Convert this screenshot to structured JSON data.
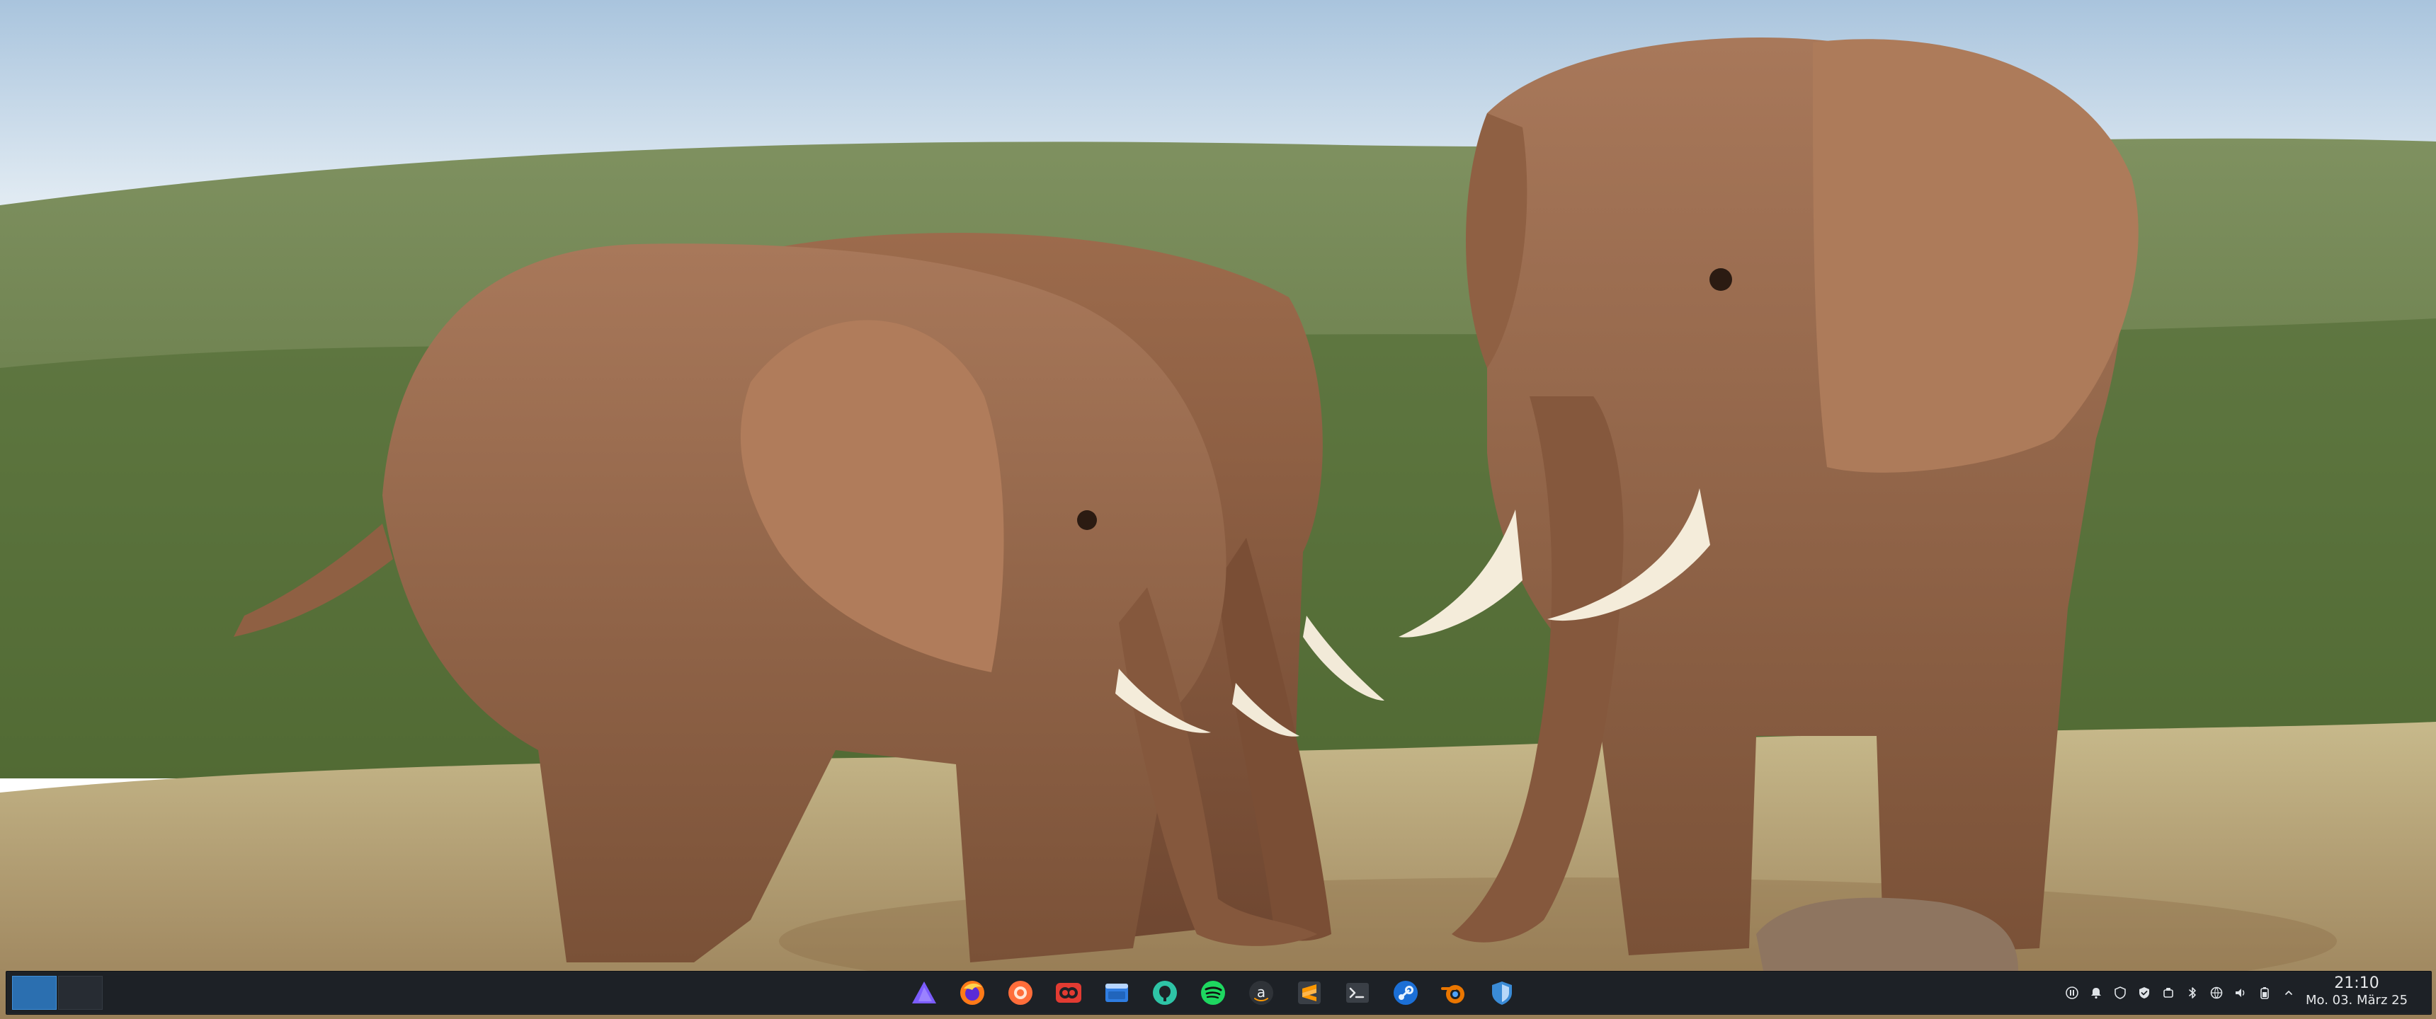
{
  "desktop": {
    "wallpaper": "elephants",
    "sky_color": "#c9d8e6",
    "hills_color": "#6f8450",
    "grass_color": "#c9b889",
    "elephant_color": "#9a6b4c"
  },
  "taskbar": {
    "background": "#1d2126",
    "pager": {
      "desktops": 2,
      "active": 1
    },
    "tasks": [
      {
        "name": "proton-vpn",
        "icon": "triangle-icon",
        "color": "#7b5cff"
      },
      {
        "name": "firefox",
        "icon": "firefox-icon",
        "color": "#ff7a18"
      },
      {
        "name": "orange-circle-app",
        "icon": "orange-circle-icon",
        "color": "#ff6d3a"
      },
      {
        "name": "davinci-resolve",
        "icon": "resolve-icon",
        "color": "#e23b32"
      },
      {
        "name": "file-manager",
        "icon": "folder-window-icon",
        "color": "#2f7de1"
      },
      {
        "name": "github-desktop",
        "icon": "github-icon",
        "color": "#2ec4a6"
      },
      {
        "name": "spotify",
        "icon": "spotify-icon",
        "color": "#1ed760"
      },
      {
        "name": "amazon",
        "icon": "amazon-icon",
        "color": "#2f3338"
      },
      {
        "name": "sublime-text",
        "icon": "sublime-icon",
        "color": "#ff9800"
      },
      {
        "name": "terminal",
        "icon": "terminal-icon",
        "color": "#3a3f46"
      },
      {
        "name": "steam",
        "icon": "steam-icon",
        "color": "#1b6fd6"
      },
      {
        "name": "blender",
        "icon": "blender-icon",
        "color": "#ea7600"
      },
      {
        "name": "bitwarden",
        "icon": "shield-icon",
        "color": "#3a8bd6"
      }
    ],
    "tray_icons": [
      {
        "name": "pause-icon"
      },
      {
        "name": "bell-icon"
      },
      {
        "name": "vpn-shield-icon"
      },
      {
        "name": "check-shield-icon"
      },
      {
        "name": "storage-icon"
      },
      {
        "name": "bluetooth-icon"
      },
      {
        "name": "network-icon"
      },
      {
        "name": "speaker-icon"
      },
      {
        "name": "battery-icon"
      },
      {
        "name": "expand-icon"
      }
    ],
    "clock": {
      "time": "21:10",
      "date": "Mo. 03. März 25"
    }
  }
}
